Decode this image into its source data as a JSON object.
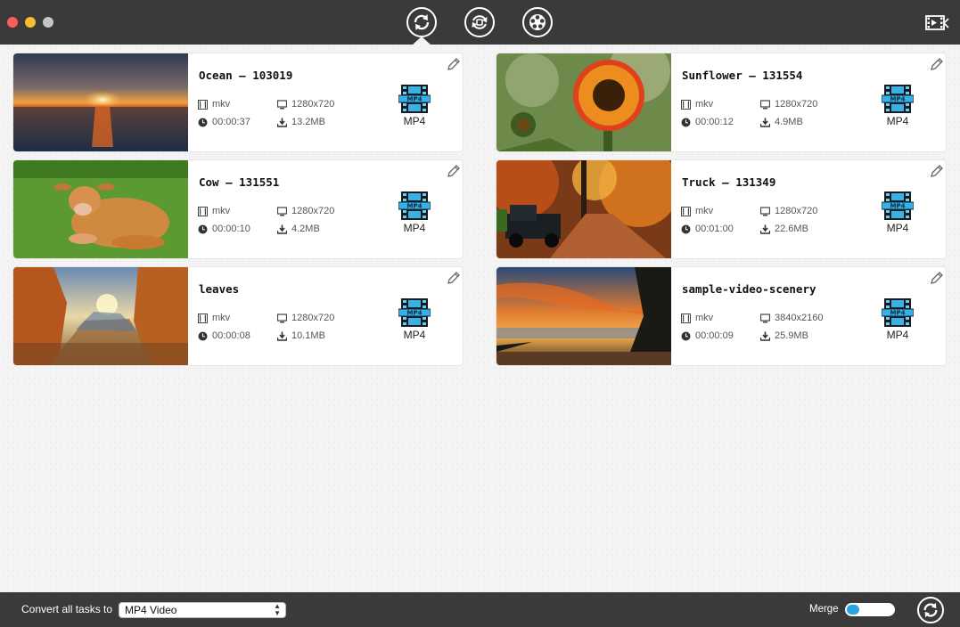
{
  "footer": {
    "convert_label": "Convert all tasks to",
    "convert_value": "MP4 Video",
    "merge_label": "Merge",
    "merge_on": false
  },
  "toolbar": {
    "modes": [
      "convert-icon",
      "rotate-icon",
      "film-reel-icon"
    ],
    "active_mode": "convert-icon"
  },
  "tasks": [
    {
      "title": "Ocean – 103019",
      "format": "mkv",
      "resolution": "1280x720",
      "duration": "00:00:37",
      "size": "13.2MB",
      "target": "MP4",
      "thumb": "sunset-ocean"
    },
    {
      "title": "Sunflower – 131554",
      "format": "mkv",
      "resolution": "1280x720",
      "duration": "00:00:12",
      "size": "4.9MB",
      "target": "MP4",
      "thumb": "sunflower"
    },
    {
      "title": "Cow – 131551",
      "format": "mkv",
      "resolution": "1280x720",
      "duration": "00:00:10",
      "size": "4.2MB",
      "target": "MP4",
      "thumb": "cow-on-grass"
    },
    {
      "title": "Truck – 131349",
      "format": "mkv",
      "resolution": "1280x720",
      "duration": "00:01:00",
      "size": "22.6MB",
      "target": "MP4",
      "thumb": "truck-autumn"
    },
    {
      "title": "leaves",
      "format": "mkv",
      "resolution": "1280x720",
      "duration": "00:00:08",
      "size": "10.1MB",
      "target": "MP4",
      "thumb": "autumn-leaves"
    },
    {
      "title": "sample-video-scenery",
      "format": "mkv",
      "resolution": "3840x2160",
      "duration": "00:00:09",
      "size": "25.9MB",
      "target": "MP4",
      "thumb": "sunset-beach"
    }
  ]
}
